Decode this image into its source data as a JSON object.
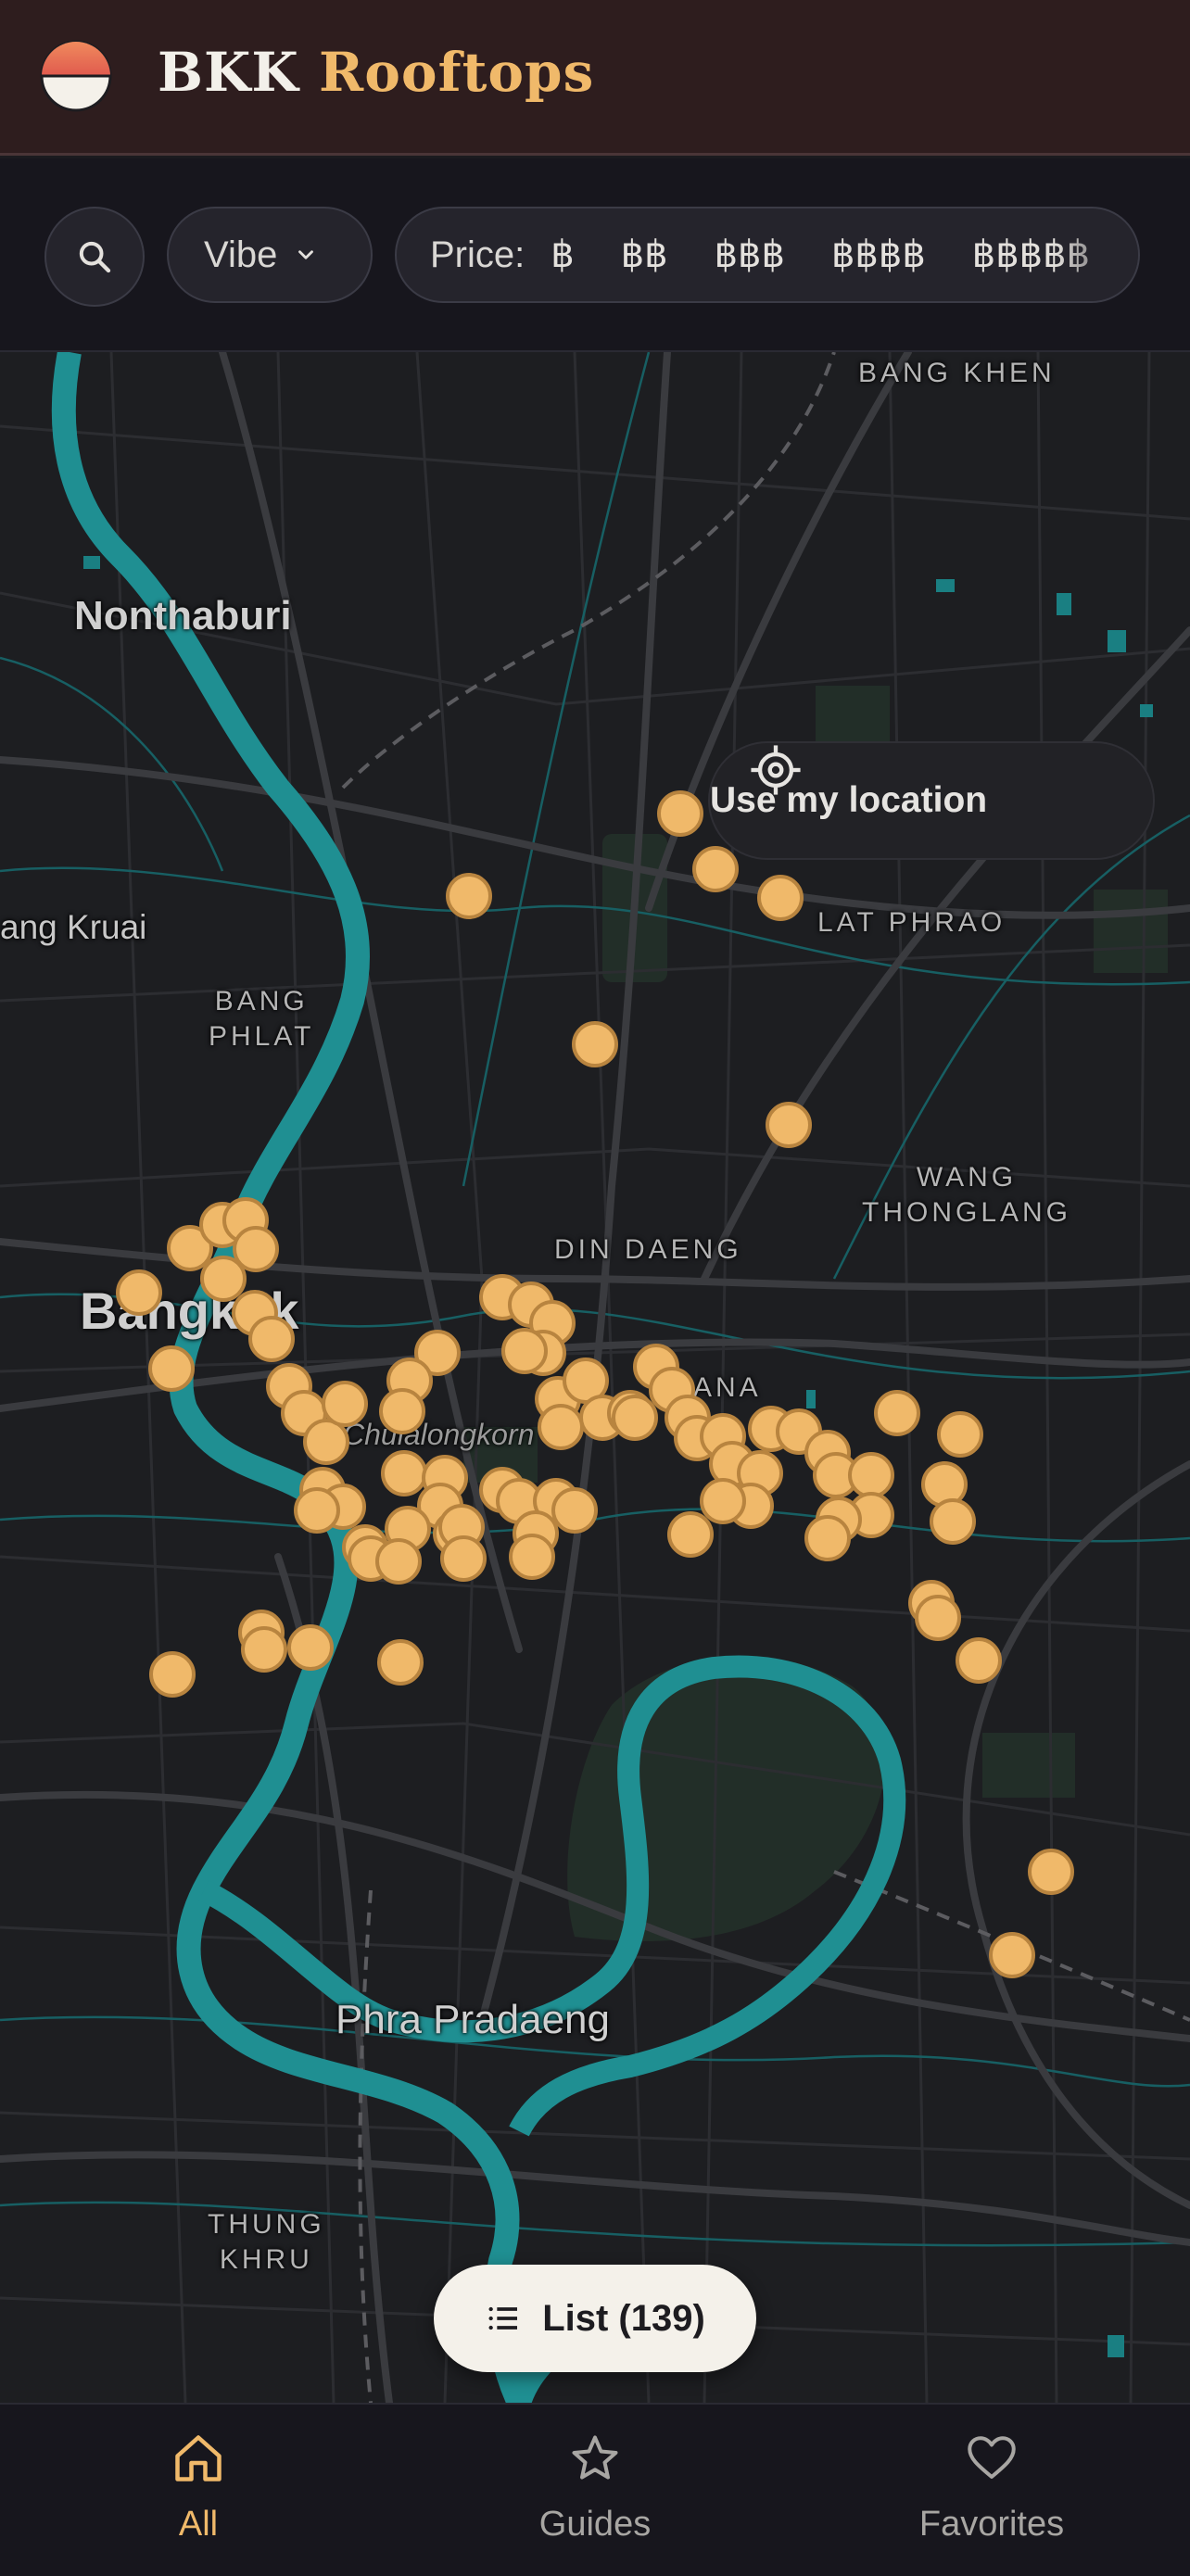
{
  "header": {
    "brand_primary": "BKK",
    "brand_accent": "Rooftops",
    "logo": "sunset-logo-icon"
  },
  "filters": {
    "search_icon": "search-icon",
    "vibe_label": "Vibe",
    "price_label": "Price:",
    "price_options": [
      "฿",
      "฿฿",
      "฿฿฿",
      "฿฿฿฿",
      "฿฿฿฿฿"
    ]
  },
  "map": {
    "locate_label": "Use my location",
    "places": {
      "nonthaburi": "Nonthaburi",
      "bang_kruai": "ang Kruai",
      "bang_phlat": "BANG\nPHLAT",
      "bangkok": "Bangkok",
      "din_daeng": "DIN DAENG",
      "lat_phrao": "LAT PHRAO",
      "wang_thonglang": "WANG\nTHONGLANG",
      "bang_khen": "BANG KHEN",
      "chulalongkorn": "Chulalongkorn",
      "phra_pradaeng": "Phra Pradaeng",
      "thung_khru": "THUNG\nKHRU",
      "ana": "ANA"
    },
    "list_button": "List (139)"
  },
  "colors": {
    "accent": "#f0b96a",
    "river": "#1f8f92",
    "marker": "#f0b96a",
    "header_bg": "#2e1d1e"
  },
  "nav": {
    "all": "All",
    "guides": "Guides",
    "favorites": "Favorites"
  }
}
